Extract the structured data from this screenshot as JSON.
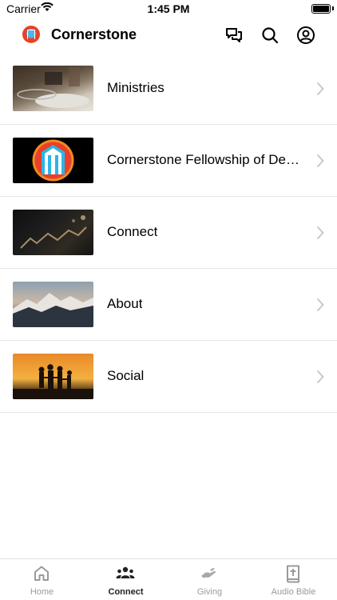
{
  "status_bar": {
    "carrier": "Carrier",
    "time": "1:45 PM"
  },
  "header": {
    "title": "Cornerstone",
    "icons": [
      "chat-icon",
      "search-icon",
      "profile-icon"
    ]
  },
  "list": {
    "items": [
      {
        "label": "Ministries",
        "thumb": "room-photo"
      },
      {
        "label": "Cornerstone Fellowship of DeG...",
        "thumb": "cornerstone-logo"
      },
      {
        "label": "Connect",
        "thumb": "worship-hands-photo"
      },
      {
        "label": "About",
        "thumb": "mountains-photo"
      },
      {
        "label": "Social",
        "thumb": "family-sunset-photo"
      }
    ]
  },
  "tabbar": {
    "tabs": [
      {
        "label": "Home",
        "icon": "home-icon",
        "active": false
      },
      {
        "label": "Connect",
        "icon": "people-icon",
        "active": true
      },
      {
        "label": "Giving",
        "icon": "giving-hand-icon",
        "active": false
      },
      {
        "label": "Audio Bible",
        "icon": "bible-icon",
        "active": false
      }
    ]
  },
  "colors": {
    "active_tab": "#222222",
    "inactive_tab": "#9a9a9a",
    "divider": "#e6e6e6"
  }
}
